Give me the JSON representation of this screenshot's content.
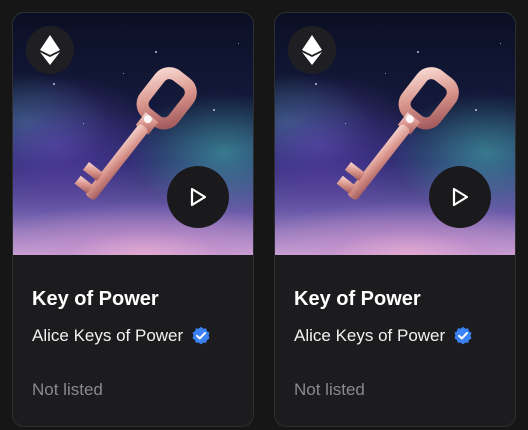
{
  "cards": [
    {
      "title": "Key of Power",
      "creator": "Alice Keys of Power",
      "status": "Not listed",
      "chain_icon": "ethereum-icon",
      "action_icon": "play-icon",
      "verified_icon": "verified-badge-icon"
    },
    {
      "title": "Key of Power",
      "creator": "Alice Keys of Power",
      "status": "Not listed",
      "chain_icon": "ethereum-icon",
      "action_icon": "play-icon",
      "verified_icon": "verified-badge-icon"
    }
  ],
  "colors": {
    "background": "#161616",
    "card": "#1c1c1e",
    "verified": "#3b82f6",
    "muted_text": "#8a8a8e"
  }
}
